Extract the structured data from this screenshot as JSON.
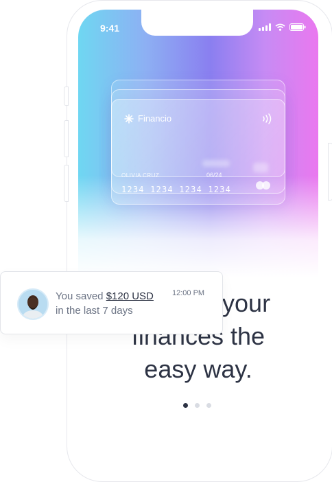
{
  "status_bar": {
    "time": "9:41"
  },
  "card": {
    "brand": "Financio",
    "holder_name": "OLIVIA CRUZ",
    "expiry": "06/24",
    "number": "1234 1234 1234 1234"
  },
  "headline": {
    "line1": "Manage your",
    "line2": "finances the",
    "line3": "easy way."
  },
  "pagination": {
    "count": 3,
    "active_index": 0
  },
  "notification": {
    "text_prefix": "You saved ",
    "amount": "$120 USD",
    "text_suffix": "in the last 7 days",
    "time": "12:00 PM"
  },
  "colors": {
    "gradient_start": "#6fd7f2",
    "gradient_mid": "#8a7ff0",
    "gradient_end": "#ea78ef",
    "text_dark": "#2d3344",
    "text_muted": "#6b7384"
  }
}
